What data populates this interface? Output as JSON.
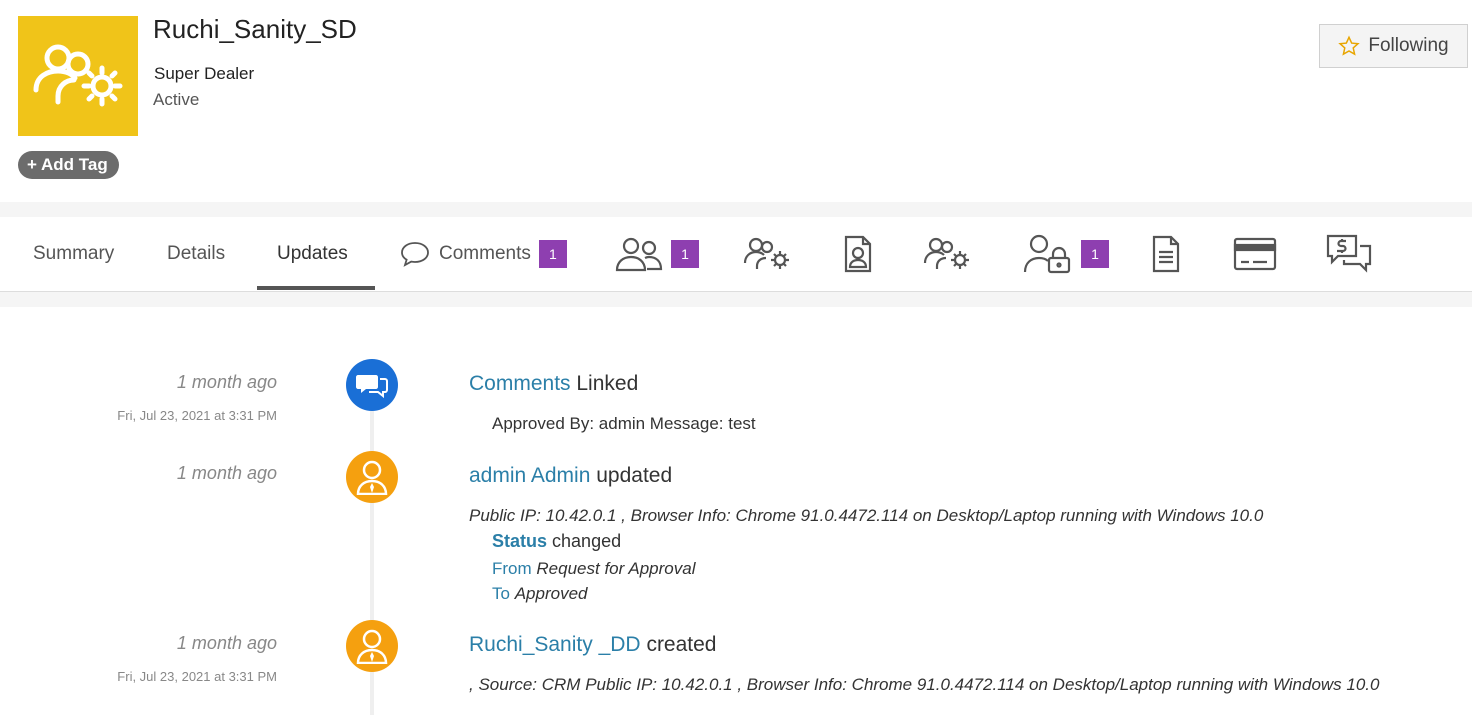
{
  "record": {
    "title": "Ruchi_Sanity_SD",
    "role": "Super Dealer",
    "status": "Active",
    "add_tag_label": "+ Add Tag",
    "following_label": "Following"
  },
  "tabs": [
    {
      "label": "Summary"
    },
    {
      "label": "Details"
    },
    {
      "label": "Updates"
    },
    {
      "label": "Comments",
      "badge": "1"
    },
    {
      "icon": "users-icon",
      "badge": "1"
    },
    {
      "icon": "users-gear-icon"
    },
    {
      "icon": "contact-document-icon"
    },
    {
      "icon": "users-gear-icon"
    },
    {
      "icon": "user-lock-icon",
      "badge": "1"
    },
    {
      "icon": "document-icon"
    },
    {
      "icon": "credit-card-icon"
    },
    {
      "icon": "dollar-chat-icon"
    }
  ],
  "updates": [
    {
      "ago": "1 month ago",
      "date": "Fri, Jul 23, 2021 at 3:31 PM",
      "title_link": "Comments",
      "title_rest": "Linked",
      "detail": "Approved By: admin Message: test"
    },
    {
      "ago": "1 month ago",
      "title_link": "admin Admin",
      "title_rest": "updated",
      "info": "Public IP: 10.42.0.1 , Browser Info: Chrome 91.0.4472.114 on Desktop/Laptop running with Windows 10.0",
      "field_label": "Status",
      "field_changed": "changed",
      "from_label": "From",
      "from_value": "Request for Approval",
      "to_label": "To",
      "to_value": "Approved"
    },
    {
      "ago": "1 month ago",
      "date": "Fri, Jul 23, 2021 at 3:31 PM",
      "title_link": "Ruchi_Sanity _DD",
      "title_rest": "created",
      "info": ", Source: CRM Public IP: 10.42.0.1 , Browser Info: Chrome 91.0.4472.114 on Desktop/Laptop running with Windows 10.0"
    }
  ],
  "colors": {
    "avatar_bg": "#f0c419",
    "badge": "#8e3fb0",
    "link": "#2b7fa8",
    "comment_circle": "#1a6fd6",
    "user_circle": "#f5a00f"
  }
}
